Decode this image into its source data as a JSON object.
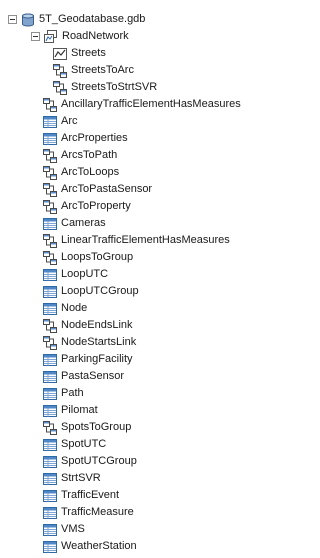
{
  "root": {
    "label": "5T_Geodatabase.gdb",
    "expanded": true,
    "icon": "geodatabase-icon"
  },
  "dataset": {
    "label": "RoadNetwork",
    "expanded": true,
    "icon": "feature-dataset-icon"
  },
  "dataset_children": [
    {
      "label": "Streets",
      "icon": "line-feature-class-icon"
    },
    {
      "label": "StreetsToArc",
      "icon": "relationship-class-icon"
    },
    {
      "label": "StreetsToStrtSVR",
      "icon": "relationship-class-icon"
    }
  ],
  "items": [
    {
      "label": "AncillaryTrafficElementHasMeasures",
      "icon": "relationship-class-icon"
    },
    {
      "label": "Arc",
      "icon": "table-icon"
    },
    {
      "label": "ArcProperties",
      "icon": "table-icon"
    },
    {
      "label": "ArcsToPath",
      "icon": "relationship-class-icon"
    },
    {
      "label": "ArcToLoops",
      "icon": "relationship-class-icon"
    },
    {
      "label": "ArcToPastaSensor",
      "icon": "relationship-class-icon"
    },
    {
      "label": "ArcToProperty",
      "icon": "relationship-class-icon"
    },
    {
      "label": "Cameras",
      "icon": "table-icon"
    },
    {
      "label": "LinearTrafficElementHasMeasures",
      "icon": "relationship-class-icon"
    },
    {
      "label": "LoopsToGroup",
      "icon": "relationship-class-icon"
    },
    {
      "label": "LoopUTC",
      "icon": "table-icon"
    },
    {
      "label": "LoopUTCGroup",
      "icon": "table-icon"
    },
    {
      "label": "Node",
      "icon": "table-icon"
    },
    {
      "label": "NodeEndsLink",
      "icon": "relationship-class-icon"
    },
    {
      "label": "NodeStartsLink",
      "icon": "relationship-class-icon"
    },
    {
      "label": "ParkingFacility",
      "icon": "table-icon"
    },
    {
      "label": "PastaSensor",
      "icon": "table-icon"
    },
    {
      "label": "Path",
      "icon": "table-icon"
    },
    {
      "label": "Pilomat",
      "icon": "table-icon"
    },
    {
      "label": "SpotsToGroup",
      "icon": "relationship-class-icon"
    },
    {
      "label": "SpotUTC",
      "icon": "table-icon"
    },
    {
      "label": "SpotUTCGroup",
      "icon": "table-icon"
    },
    {
      "label": "StrtSVR",
      "icon": "table-icon"
    },
    {
      "label": "TrafficEvent",
      "icon": "table-icon"
    },
    {
      "label": "TrafficMeasure",
      "icon": "table-icon"
    },
    {
      "label": "VMS",
      "icon": "table-icon"
    },
    {
      "label": "WeatherStation",
      "icon": "table-icon"
    }
  ]
}
